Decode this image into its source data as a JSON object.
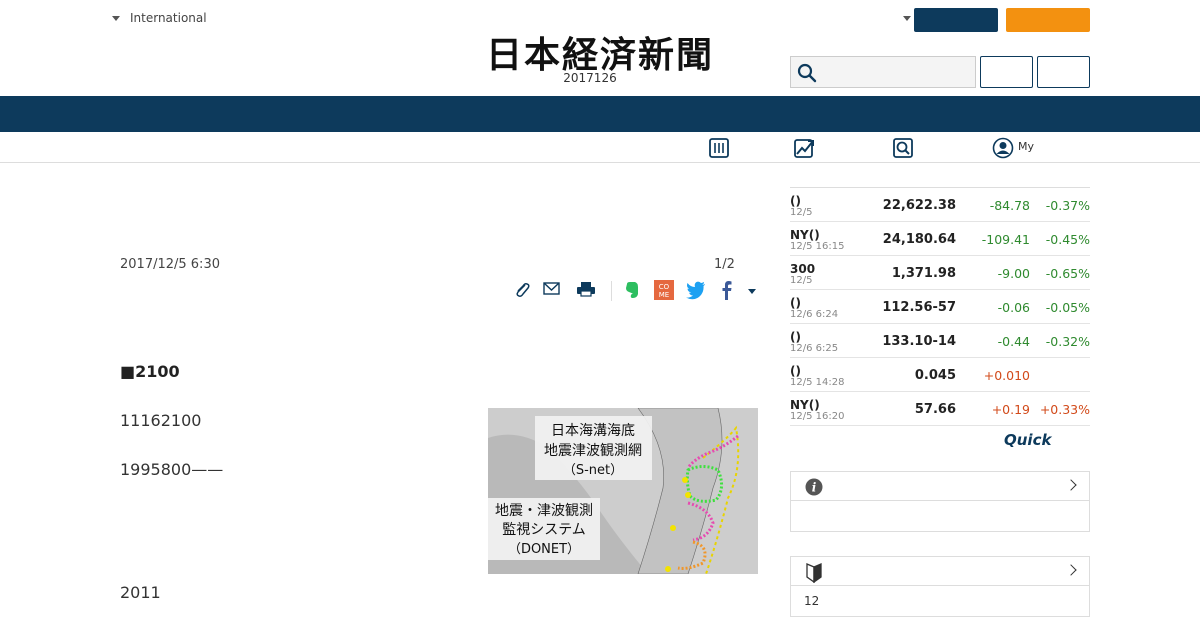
{
  "header": {
    "region_label": "International",
    "logo_text": "日本経済新聞",
    "date": "2017126"
  },
  "subnav": {
    "my_label": "My"
  },
  "article": {
    "pub_datetime": "2017/12/5 6:30",
    "page_count": "1/2",
    "headline": "■2100",
    "paragraphs": [
      "11162100",
      "1995800——",
      "2011"
    ],
    "figure": {
      "title_lines": [
        "日本海溝海底",
        "地震津波観測網",
        "（S-net）"
      ],
      "sub_lines": [
        "地震・津波観測",
        "監視システム",
        "（DONET）"
      ]
    }
  },
  "markets": {
    "rows": [
      {
        "name": "()",
        "time": "12/5",
        "value": "22,622.38",
        "change": "-84.78",
        "pct": "-0.37%",
        "dir": "neg"
      },
      {
        "name": "NY()",
        "time": "12/5 16:15",
        "value": "24,180.64",
        "change": "-109.41",
        "pct": "-0.45%",
        "dir": "neg"
      },
      {
        "name": "300",
        "time": "12/5",
        "value": "1,371.98",
        "change": "-9.00",
        "pct": "-0.65%",
        "dir": "neg"
      },
      {
        "name": "()",
        "time": "12/6 6:24",
        "value": "112.56-57",
        "change": "-0.06",
        "pct": "-0.05%",
        "dir": "neg"
      },
      {
        "name": "()",
        "time": "12/6 6:25",
        "value": "133.10-14",
        "change": "-0.44",
        "pct": "-0.32%",
        "dir": "neg"
      },
      {
        "name": "()",
        "time": "12/5 14:28",
        "value": "0.045",
        "change": "+0.010",
        "pct": "",
        "dir": "pos"
      },
      {
        "name": "NY()",
        "time": "12/5 16:20",
        "value": "57.66",
        "change": "+0.19",
        "pct": "+0.33%",
        "dir": "pos"
      }
    ],
    "provider_logo": "Quick"
  },
  "boxes": {
    "box2_body": "12"
  },
  "colors": {
    "navy": "#0d3a5c",
    "orange": "#f39110",
    "negative": "#2f8a2f",
    "positive": "#d24a1a"
  },
  "icons": [
    "caret-down-icon",
    "search-icon",
    "newspaper-icon",
    "chart-icon",
    "search-magnifier-icon",
    "user-icon",
    "clip-icon",
    "mail-icon",
    "print-icon",
    "evernote-icon",
    "comment-icon",
    "twitter-icon",
    "facebook-icon",
    "info-icon",
    "beginner-mark-icon",
    "chevron-right-icon"
  ]
}
